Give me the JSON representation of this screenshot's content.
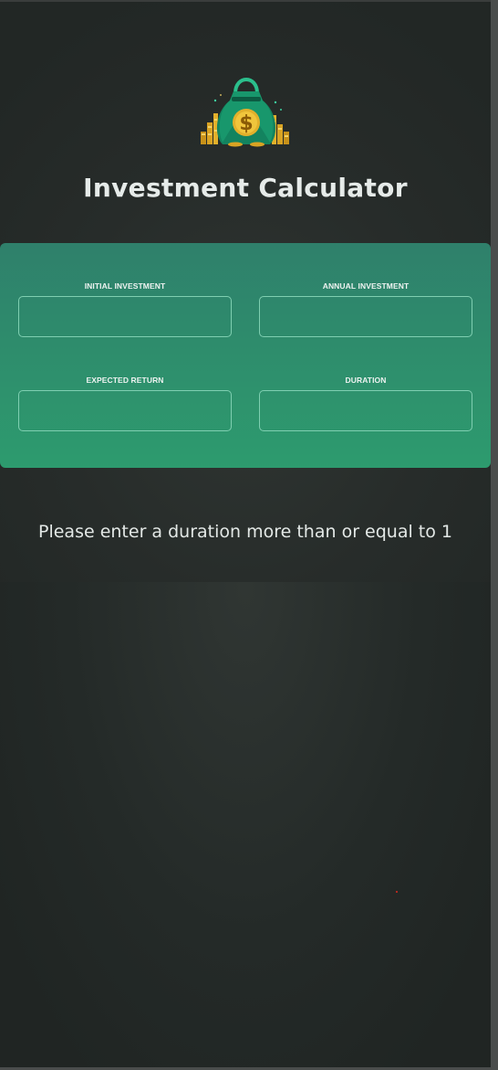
{
  "header": {
    "logo_icon": "money-bag-icon",
    "title": "Investment Calculator"
  },
  "inputs": {
    "initial_investment": {
      "label": "INITIAL INVESTMENT",
      "value": ""
    },
    "annual_investment": {
      "label": "ANNUAL INVESTMENT",
      "value": ""
    },
    "expected_return": {
      "label": "EXPECTED RETURN",
      "value": ""
    },
    "duration": {
      "label": "DURATION",
      "value": ""
    }
  },
  "message": "Please enter a duration more than or equal to 1",
  "colors": {
    "background": "#242a28",
    "card_top": "#2f806b",
    "card_bottom": "#2d9b6e",
    "input_border": "#7fcfb1",
    "text": "#e6ebe9"
  }
}
